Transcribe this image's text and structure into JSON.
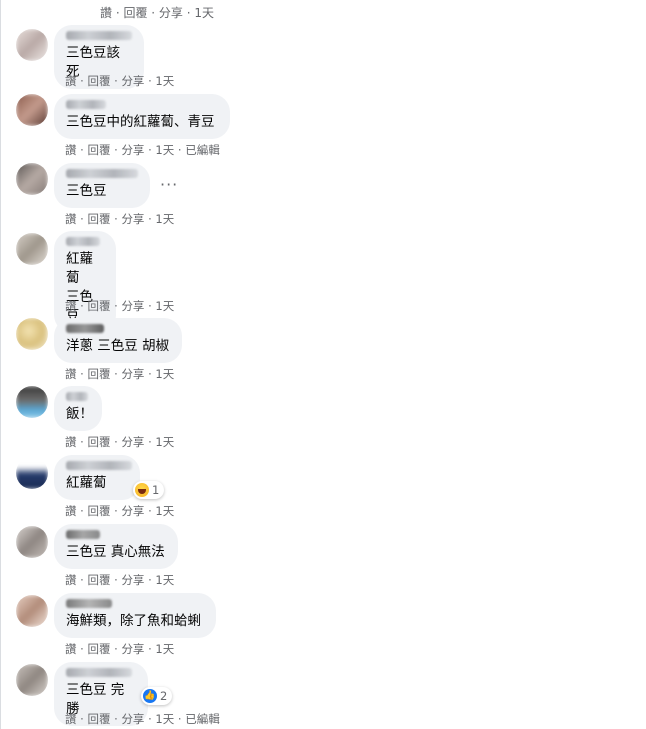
{
  "top_actions": "讚 · 回覆 · 分享 · 1天",
  "comments": [
    {
      "text": "三色豆該死",
      "meta": {
        "like": "讚",
        "reply": "回覆",
        "share": "分享",
        "time": "1天",
        "edited": ""
      }
    },
    {
      "text": "三色豆中的紅蘿蔔、青豆",
      "meta": {
        "like": "讚",
        "reply": "回覆",
        "share": "分享",
        "time": "1天",
        "edited": "已編輯"
      }
    },
    {
      "text": "三色豆",
      "meta": {
        "like": "讚",
        "reply": "回覆",
        "share": "分享",
        "time": "1天",
        "edited": ""
      }
    },
    {
      "text": "紅蘿蔔\n三色豆",
      "meta": {
        "like": "讚",
        "reply": "回覆",
        "share": "分享",
        "time": "1天",
        "edited": ""
      }
    },
    {
      "text": "洋蔥 三色豆 胡椒",
      "meta": {
        "like": "讚",
        "reply": "回覆",
        "share": "分享",
        "time": "1天",
        "edited": ""
      }
    },
    {
      "text": "飯！",
      "meta": {
        "like": "讚",
        "reply": "回覆",
        "share": "分享",
        "time": "1天",
        "edited": ""
      }
    },
    {
      "text": "紅蘿蔔",
      "reaction": {
        "type": "haha",
        "count": "1"
      },
      "meta": {
        "like": "讚",
        "reply": "回覆",
        "share": "分享",
        "time": "1天",
        "edited": ""
      }
    },
    {
      "text": "三色豆 真心無法",
      "meta": {
        "like": "讚",
        "reply": "回覆",
        "share": "分享",
        "time": "1天",
        "edited": ""
      }
    },
    {
      "text": "海鮮類，除了魚和蛤蜊",
      "meta": {
        "like": "讚",
        "reply": "回覆",
        "share": "分享",
        "time": "1天",
        "edited": ""
      }
    },
    {
      "text": "三色豆 完勝",
      "reaction": {
        "type": "like",
        "count": "2"
      },
      "meta": {
        "like": "讚",
        "reply": "回覆",
        "share": "分享",
        "time": "1天",
        "edited": "已編輯"
      }
    }
  ],
  "more_options": "···",
  "colors": {
    "bubble": "#f0f2f5",
    "meta": "#65676b",
    "like_blue": "#1877f2",
    "haha_yellow": "#f7b125"
  }
}
